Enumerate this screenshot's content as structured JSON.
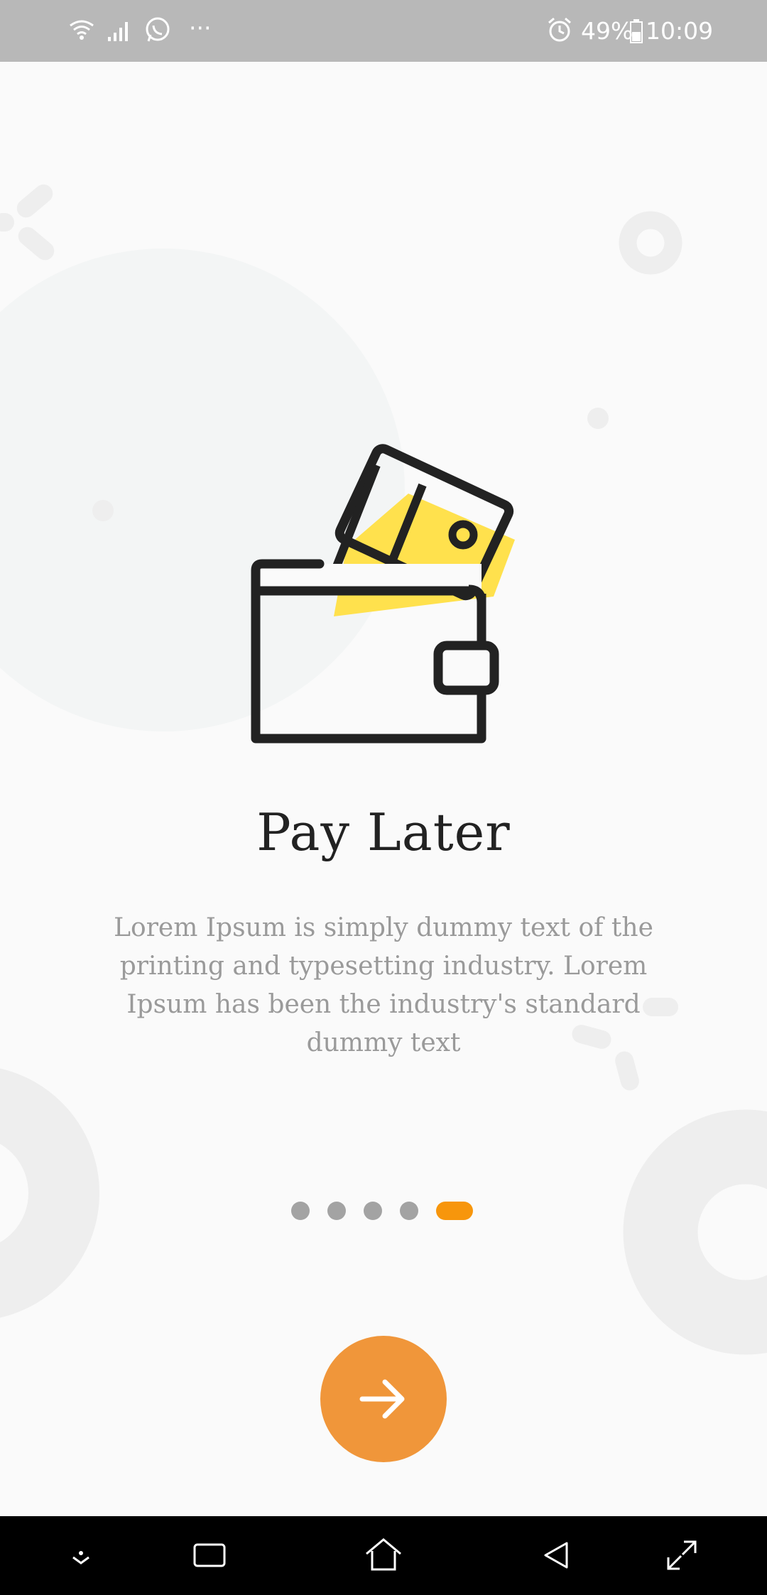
{
  "status_bar": {
    "battery": "49%",
    "time": "10:09",
    "more_indicator": "···",
    "icons": [
      "wifi-icon",
      "signal-icon",
      "whatsapp-icon",
      "alarm-icon",
      "battery-icon"
    ]
  },
  "onboarding": {
    "title": "Pay Later",
    "description": "Lorem Ipsum is simply dummy text of the printing and typesetting industry. Lorem Ipsum has been the industry's standard dummy text",
    "page_count": 5,
    "active_page": 5,
    "illustration": "wallet-card-icon"
  },
  "next_button": {
    "icon": "arrow-right-icon"
  },
  "nav_bar": {
    "icons": [
      "hide-keyboard-icon",
      "recents-icon",
      "home-icon",
      "back-icon",
      "expand-icon"
    ]
  },
  "colors": {
    "accent": "#f0963a",
    "active_dot": "#f7960c",
    "inactive_dot": "#a3a3a3",
    "card_yellow": "#ffe14d",
    "title": "#222222",
    "description": "#9a9a9a",
    "status_bar": "#b8b8b8",
    "nav_bar": "#000000"
  }
}
